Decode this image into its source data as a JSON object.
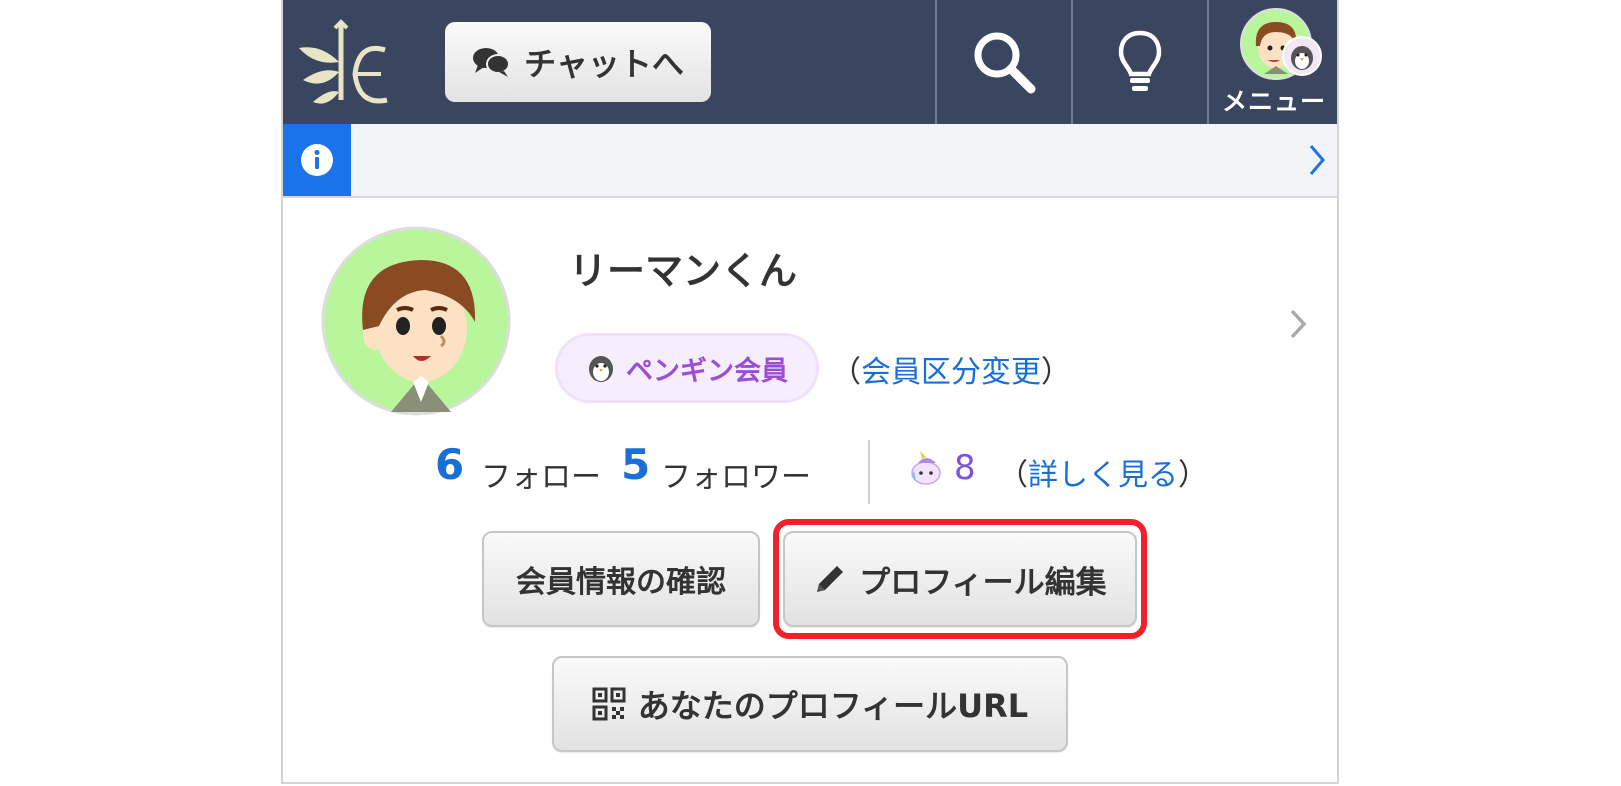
{
  "header": {
    "chat_button": "チャットへ",
    "menu_label": "メニュー"
  },
  "profile": {
    "name": "リーマンくん",
    "membership_badge": "ペンギン会員",
    "paren_open": "（",
    "change_link": "会員区分変更",
    "paren_close": "）"
  },
  "stats": {
    "follow_count": "6",
    "follow_label": "フォロー",
    "follower_count": "5",
    "follower_label": "フォロワー",
    "unicorn_count": "8",
    "paren_open": "（",
    "details_link": "詳しく見る",
    "paren_close": "）"
  },
  "buttons": {
    "confirm_info": "会員情報の確認",
    "edit_profile": "プロフィール編集",
    "profile_url": "あなたのプロフィールURL"
  },
  "colors": {
    "header_bg": "#3a4660",
    "link": "#1a6fd6",
    "badge_text": "#9b4ed4",
    "highlight": "#f2202a",
    "info_tab": "#1a73e8"
  },
  "icons": {
    "logo": "bamboo-logo",
    "chat": "chat-bubbles-icon",
    "search": "search-icon",
    "hint": "lightbulb-icon",
    "info": "info-icon",
    "chevron": "chevron-right-icon",
    "penguin": "penguin-icon",
    "unicorn": "unicorn-icon",
    "pencil": "pencil-icon",
    "qr": "qr-code-icon"
  }
}
